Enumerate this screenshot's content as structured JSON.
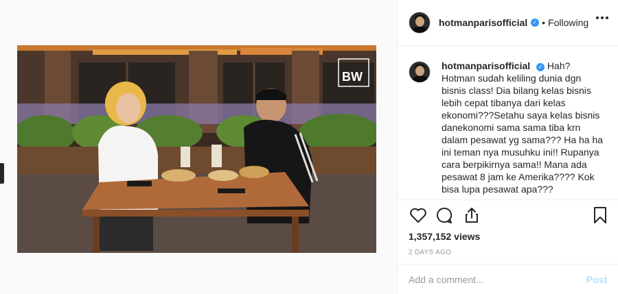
{
  "post": {
    "username": "hotmanparisofficial",
    "verified_mark": "✓",
    "separator": "•",
    "follow_status": "Following",
    "more_icon": "more-horizontal-icon",
    "caption": "Hah? Hotman sudah keliling dunia dgn bisnis class! Dia bilang kelas bisnis lebih cepat tibanya dari kelas ekonomi???Setahu saya kelas bisnis danekonomi sama sama tiba krn dalam pesawat yg sama??? Ha ha ha ini teman nya musuhku ini!! Rupanya cara berpikirnya sama!! Mana ada pesawat 8 jam ke Amerika???? Kok bisa lupa pesawat apa???",
    "views": "1,357,152 views",
    "time_ago": "2 DAYS AGO"
  },
  "video": {
    "watermark": "BW"
  },
  "actions": {
    "like_icon": "heart-icon",
    "comment_icon": "comment-icon",
    "share_icon": "share-icon",
    "save_icon": "bookmark-icon"
  },
  "comment": {
    "placeholder": "Add a comment...",
    "post_label": "Post"
  },
  "colors": {
    "verified": "#3897f0",
    "post_disabled": "#b2dffc",
    "border": "#efefef"
  }
}
